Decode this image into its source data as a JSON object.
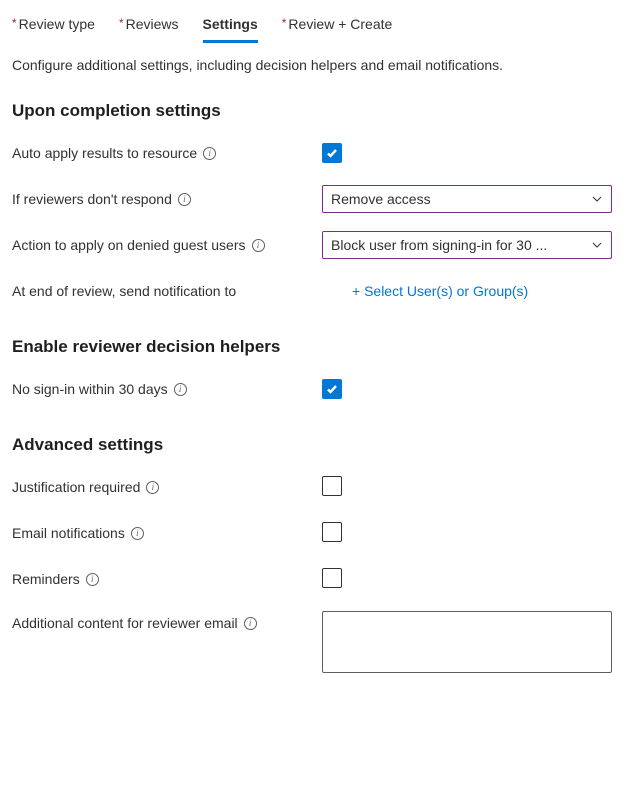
{
  "tabs": [
    {
      "label": "Review type",
      "required": true,
      "active": false
    },
    {
      "label": "Reviews",
      "required": true,
      "active": false
    },
    {
      "label": "Settings",
      "required": false,
      "active": true
    },
    {
      "label": "Review + Create",
      "required": true,
      "active": false
    }
  ],
  "description": "Configure additional settings, including decision helpers and email notifications.",
  "sections": {
    "upon_completion": {
      "title": "Upon completion settings",
      "auto_apply": {
        "label": "Auto apply results to resource",
        "checked": true
      },
      "no_respond": {
        "label": "If reviewers don't respond",
        "value": "Remove access"
      },
      "denied_guest": {
        "label": "Action to apply on denied guest users",
        "value": "Block user from signing-in for 30 ..."
      },
      "notification": {
        "label": "At end of review, send notification to",
        "link": "+ Select User(s) or Group(s)"
      }
    },
    "decision_helpers": {
      "title": "Enable reviewer decision helpers",
      "no_signin": {
        "label": "No sign-in within 30 days",
        "checked": true
      }
    },
    "advanced": {
      "title": "Advanced settings",
      "justification": {
        "label": "Justification required",
        "checked": false
      },
      "email_notifications": {
        "label": "Email notifications",
        "checked": false
      },
      "reminders": {
        "label": "Reminders",
        "checked": false
      },
      "additional_content": {
        "label": "Additional content for reviewer email",
        "value": ""
      }
    }
  }
}
